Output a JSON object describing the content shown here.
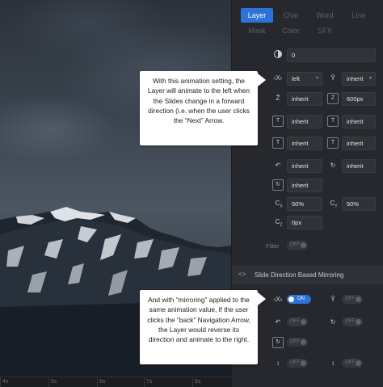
{
  "tabs": {
    "row1": [
      "Layer",
      "Char",
      "Word",
      "Line"
    ],
    "row2": [
      "Mask",
      "Color",
      "SFX"
    ],
    "active": "Layer"
  },
  "fields": {
    "opacity": "0",
    "x": "left",
    "y": "inherit",
    "z": "inherit",
    "perspective": "600px",
    "scale_x": "inherit",
    "scale_y": "inherit",
    "rotate_x": "inherit",
    "rotate_y": "inherit",
    "rotate_z": "inherit",
    "skew_x": "50%",
    "skew_y": "50%",
    "skew_z": "0px"
  },
  "filter": {
    "label": "Filter",
    "toggle": "OFF"
  },
  "mirroring": {
    "title": "Slide Direction Based Mirroring",
    "x_toggle": "ON",
    "y_toggle": "OFF",
    "rx_toggle": "OFF",
    "ry_toggle": "OFF",
    "rz_toggle": "OFF",
    "sx_toggle": "OFF",
    "sy_toggle": "OFF"
  },
  "icons": {
    "opacity": "opacity-icon",
    "x": "x-axis-icon",
    "y": "y-axis-icon",
    "z": "z-axis-icon",
    "perspective": "perspective-icon",
    "scale_x": "scale-x-icon",
    "scale_y": "scale-y-icon",
    "rotate_x": "rotate-x-icon",
    "rotate_y": "rotate-y-icon",
    "rotate_z": "rotate-z-icon",
    "skew_x": "skew-x-icon",
    "skew_y": "skew-y-icon",
    "skew_z": "skew-z-icon",
    "mirror": "mirror-arrows-icon"
  },
  "callouts": {
    "first": "With this animation setting, the Layer will animate to the left when the Slides change in a forward direction (i.e. when the user clicks the “Next” Arrow.",
    "second": "And with “mirroring” applied to the same animation value, if the user clicks the “back” Navigation Arrow, the Layer would reverse its direction and animate to the right."
  },
  "timeline": {
    "ticks": [
      "4s",
      "5s",
      "6s",
      "7s",
      "8s"
    ]
  },
  "colors": {
    "accent": "#2b73d6",
    "panel": "#26282d",
    "field": "#2f3237"
  }
}
